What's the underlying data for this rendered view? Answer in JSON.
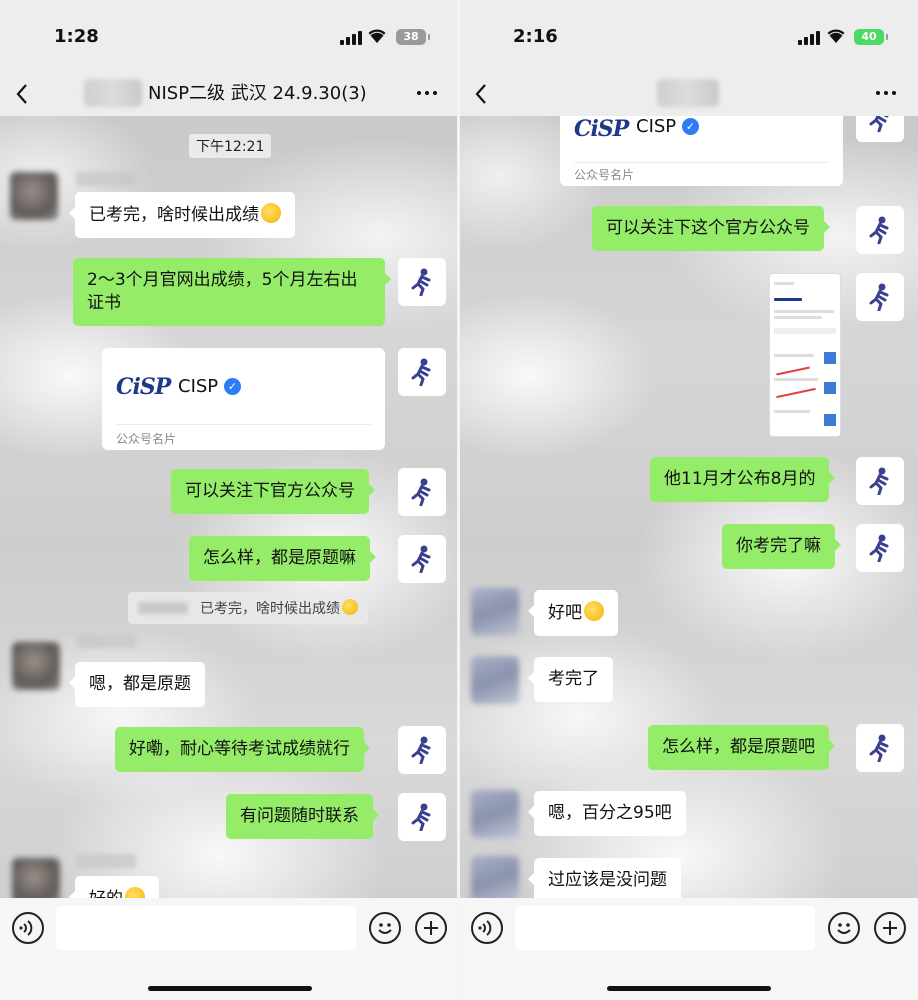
{
  "left": {
    "status": {
      "time": "1:28",
      "battery": "38"
    },
    "nav": {
      "title": "NISP二级 武汉 24.9.30(3)"
    },
    "timestamp": "下午12:21",
    "messages": {
      "m1": "已考完，啥时候出成绩",
      "m2": "2～3个月官网出成绩，5个月左右出证书",
      "m3_card_name": "CISP",
      "m3_card_label": "公众号名片",
      "m3_logo": "CiSP",
      "m4": "可以关注下官方公众号",
      "m5": "怎么样，都是原题嘛",
      "m5_quote": "已考完，啥时候出成绩",
      "m6": "嗯，都是原题",
      "m7": "好嘞，耐心等待考试成绩就行",
      "m8": "有问题随时联系",
      "m9": "好的"
    }
  },
  "right": {
    "status": {
      "time": "2:16",
      "battery": "40"
    },
    "messages": {
      "r0_card_name": "CISP",
      "r0_card_label": "公众号名片",
      "r0_logo": "CiSP",
      "r1": "可以关注下这个官方公众号",
      "r2": "他11月才公布8月的",
      "r3": "你考完了嘛",
      "r4": "好吧",
      "r5": "考完了",
      "r6": "怎么样，都是原题吧",
      "r7": "嗯，百分之95吧",
      "r8": "过应该是没问题"
    }
  },
  "icons": {
    "self_avatar": "running-man-icon",
    "emoji": "emoji-face-icon",
    "verified": "verified-badge-icon"
  },
  "colors": {
    "self_bubble": "#95ec69",
    "other_bubble": "#ffffff",
    "verified_blue": "#2d7cf6",
    "battery_green": "#4cd964"
  }
}
